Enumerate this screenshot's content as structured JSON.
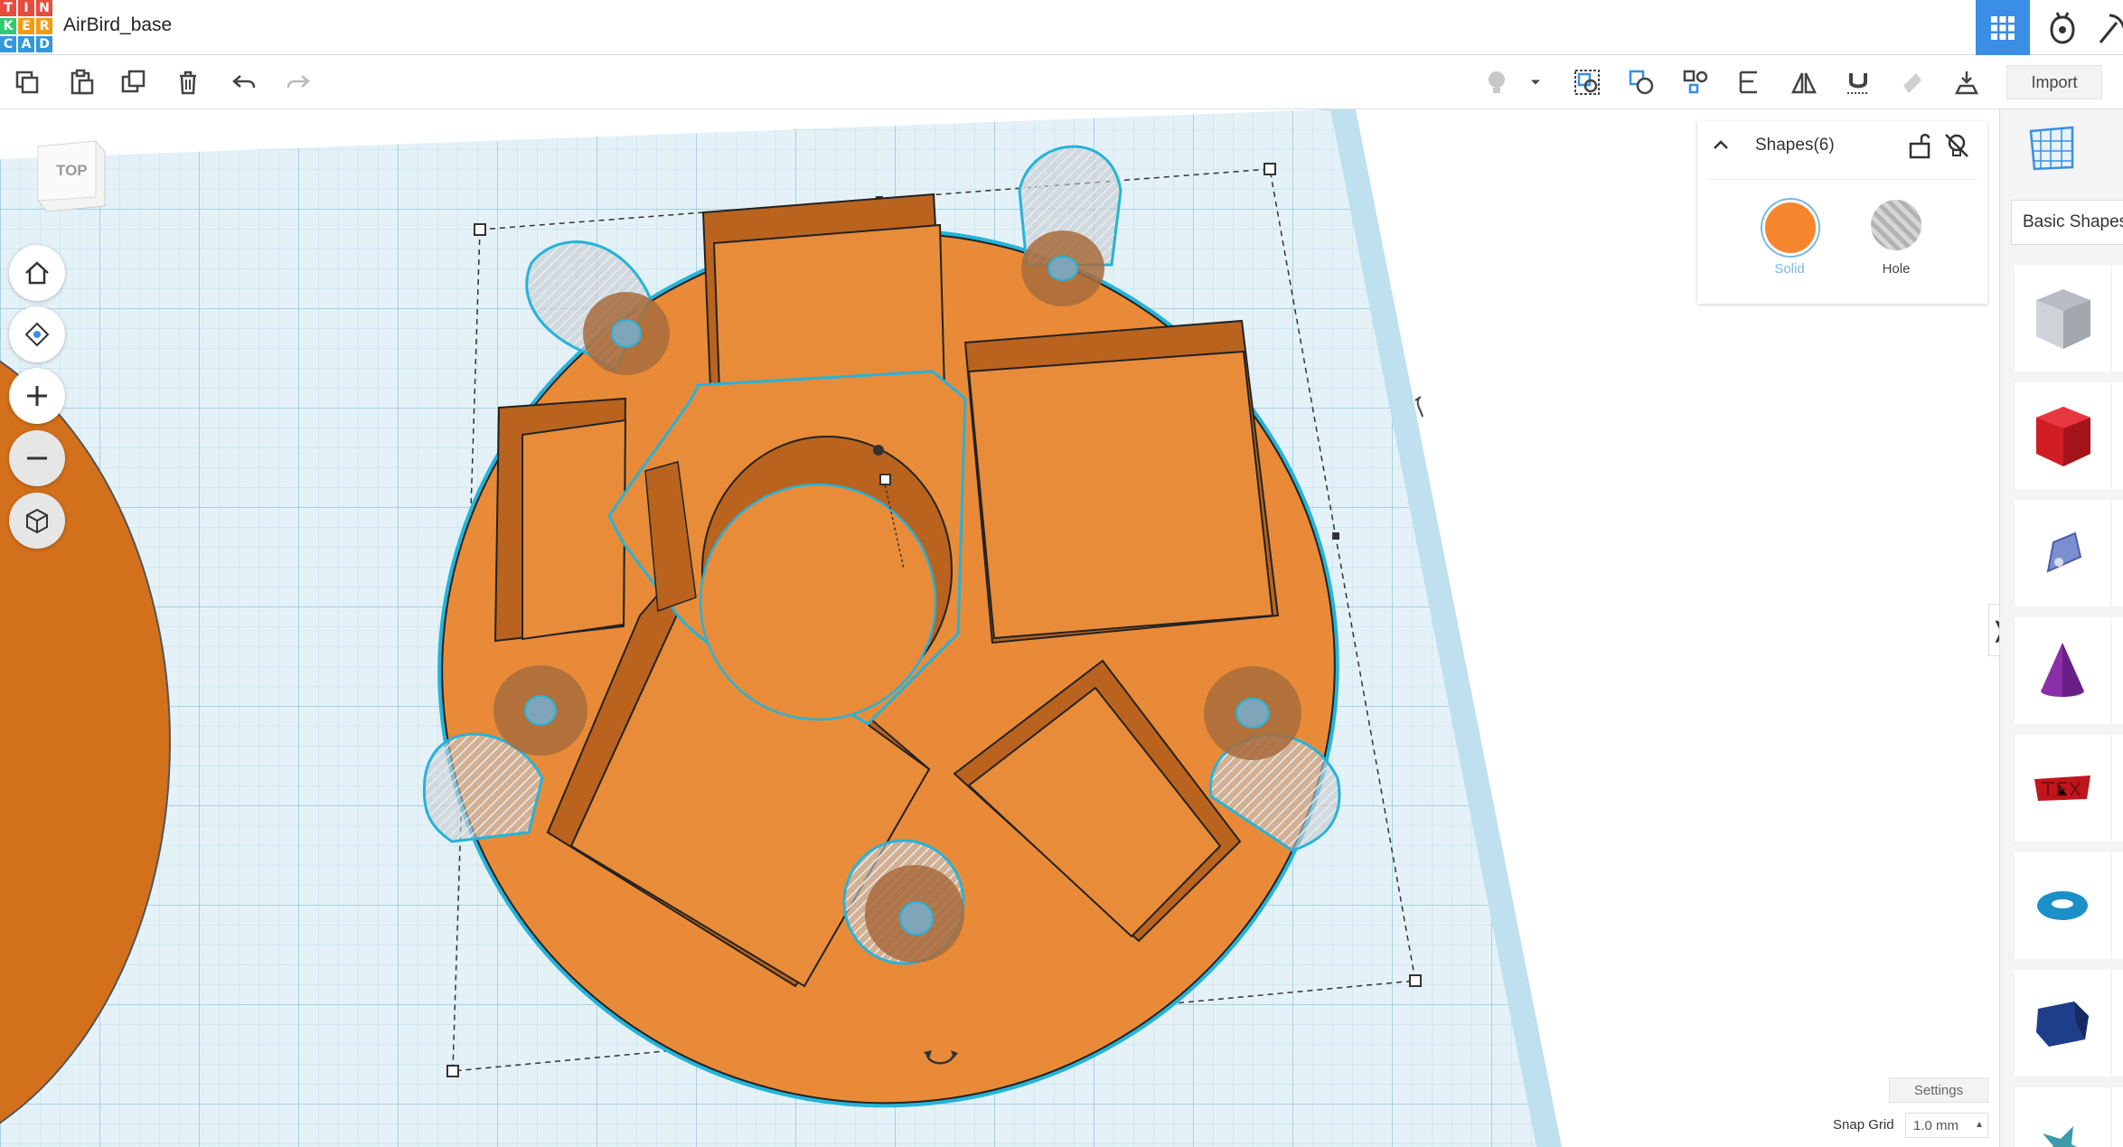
{
  "app": {
    "logo_letters": [
      "T",
      "I",
      "N",
      "K",
      "E",
      "R",
      "C",
      "A",
      "D"
    ],
    "logo_colors": [
      "#e84c3d",
      "#e84c3d",
      "#e84c3d",
      "#2ecc71",
      "#f39c12",
      "#f39c12",
      "#3498db",
      "#3498db",
      "#3498db"
    ],
    "document_title": "AirBird_base"
  },
  "top_right": {
    "icons": [
      "grid-view-icon",
      "blocks-icon",
      "pickaxe-icon"
    ],
    "active_color": "#3a8ee6"
  },
  "toolbar": {
    "left_icons": [
      "copy-icon",
      "paste-icon",
      "duplicate-icon",
      "delete-icon",
      "undo-icon",
      "redo-icon"
    ],
    "right_icons": [
      "light-bulb-icon",
      "dropdown-icon",
      "group-icon",
      "ungroup-icon",
      "align-icon",
      "mirror-icon",
      "flip-icon",
      "magnet-icon",
      "cruise-icon",
      "drop-icon"
    ],
    "import_label": "Import"
  },
  "viewcube": {
    "label": "TOP"
  },
  "view_controls": [
    "home-icon",
    "fit-view-icon",
    "zoom-in-icon",
    "zoom-out-icon",
    "perspective-icon"
  ],
  "inspector": {
    "title": "Shapes(6)",
    "solid_label": "Solid",
    "hole_label": "Hole",
    "solid_color": "#f5862e",
    "hole_color": "#b9b9b9"
  },
  "shapes_panel": {
    "category_label": "Basic Shapes",
    "items": [
      "box-hole-icon",
      "box-icon",
      "scribble-icon",
      "cone-icon",
      "text-icon",
      "torus-icon",
      "polygon-icon",
      "star-icon"
    ]
  },
  "bottom": {
    "settings_label": "Settings",
    "snap_grid_label": "Snap Grid",
    "snap_grid_value": "1.0 mm"
  },
  "colors": {
    "model_orange": "#e98a38",
    "model_edge": "#26b3d9",
    "grid_blue": "#cfe8f3",
    "left_disc": "#d2701b"
  }
}
